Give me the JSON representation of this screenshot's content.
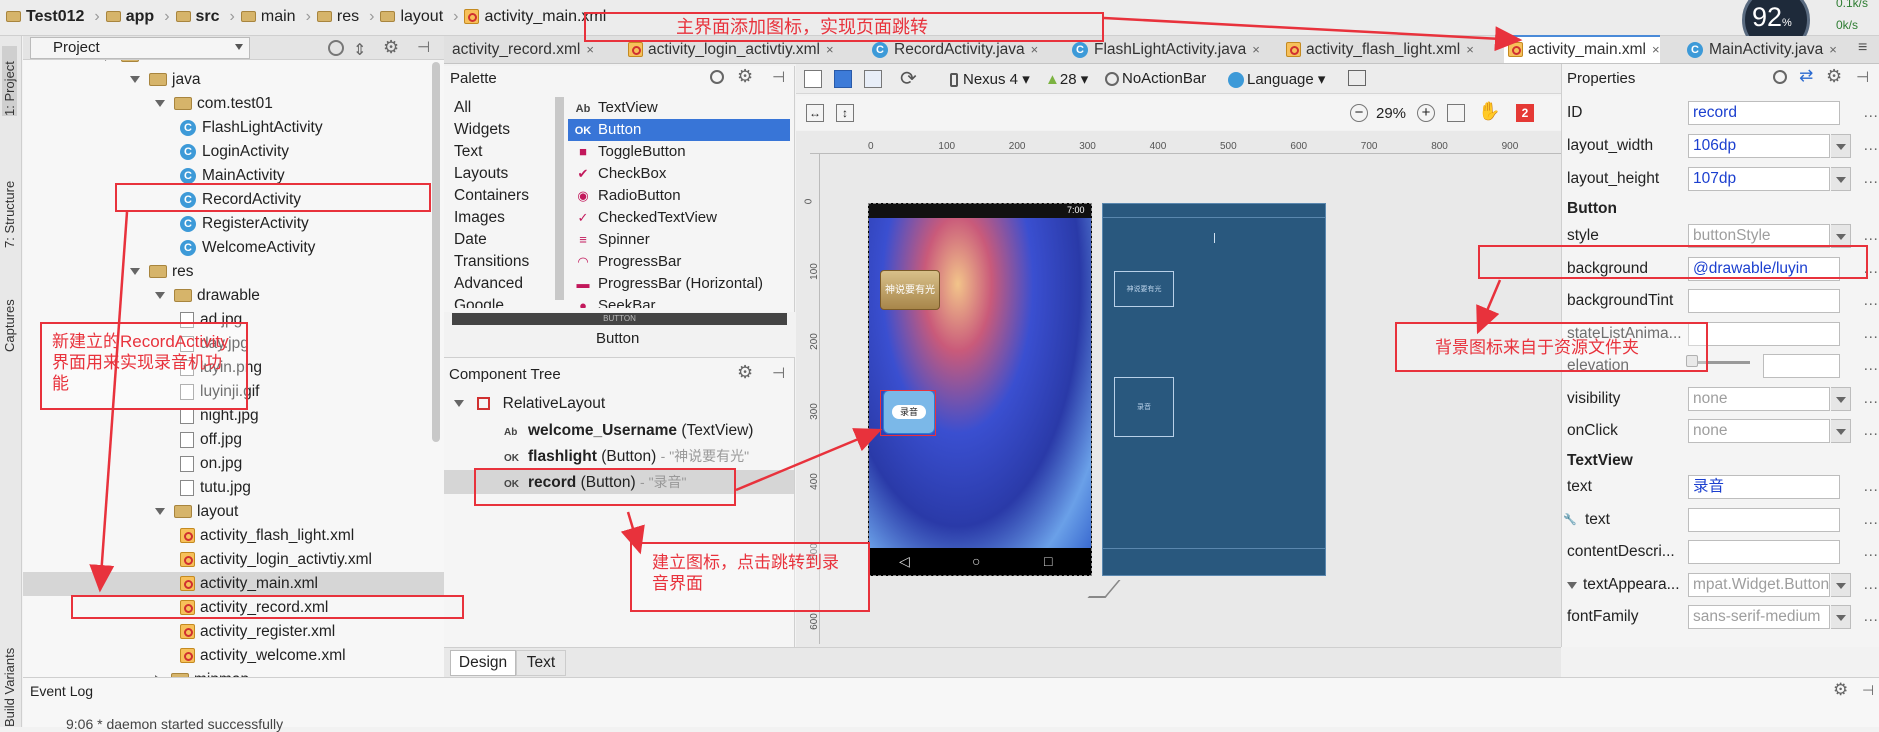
{
  "breadcrumb": [
    "Test012",
    "app",
    "src",
    "main",
    "res",
    "layout",
    "activity_main.xml"
  ],
  "cpu": {
    "value": "92",
    "unit": "%",
    "net_up": "0.1k/s",
    "net_down": "0k/s"
  },
  "left_tabs": [
    "1: Project",
    "7: Structure",
    "Captures",
    "Build Variants"
  ],
  "project": {
    "header": "Project",
    "rows": [
      {
        "label": "main",
        "kind": "folder",
        "indent": 0
      },
      {
        "label": "java",
        "kind": "folder",
        "indent": 1,
        "open": true
      },
      {
        "label": "com.test01",
        "kind": "folder",
        "indent": 2,
        "open": true
      },
      {
        "label": "FlashLightActivity",
        "kind": "class",
        "indent": 3
      },
      {
        "label": "LoginActivity",
        "kind": "class",
        "indent": 3
      },
      {
        "label": "MainActivity",
        "kind": "class",
        "indent": 3
      },
      {
        "label": "RecordActivity",
        "kind": "class",
        "indent": 3
      },
      {
        "label": "RegisterActivity",
        "kind": "class",
        "indent": 3
      },
      {
        "label": "WelcomeActivity",
        "kind": "class",
        "indent": 3
      },
      {
        "label": "res",
        "kind": "folder",
        "indent": 1,
        "open": true
      },
      {
        "label": "drawable",
        "kind": "folder",
        "indent": 2,
        "open": true
      },
      {
        "label": "ad.jpg",
        "kind": "img",
        "indent": 3
      },
      {
        "label": "day.jpg",
        "kind": "img",
        "indent": 3
      },
      {
        "label": "luyin.png",
        "kind": "img",
        "indent": 3
      },
      {
        "label": "luyinji.gif",
        "kind": "img",
        "indent": 3
      },
      {
        "label": "night.jpg",
        "kind": "img",
        "indent": 3
      },
      {
        "label": "off.jpg",
        "kind": "img",
        "indent": 3
      },
      {
        "label": "on.jpg",
        "kind": "img",
        "indent": 3
      },
      {
        "label": "tutu.jpg",
        "kind": "img",
        "indent": 3
      },
      {
        "label": "layout",
        "kind": "folder",
        "indent": 2,
        "open": true
      },
      {
        "label": "activity_flash_light.xml",
        "kind": "xml",
        "indent": 3
      },
      {
        "label": "activity_login_activtiy.xml",
        "kind": "xml",
        "indent": 3
      },
      {
        "label": "activity_main.xml",
        "kind": "xml",
        "indent": 3,
        "selected": true
      },
      {
        "label": "activity_record.xml",
        "kind": "xml",
        "indent": 3
      },
      {
        "label": "activity_register.xml",
        "kind": "xml",
        "indent": 3
      },
      {
        "label": "activity_welcome.xml",
        "kind": "xml",
        "indent": 3
      },
      {
        "label": "mipmap",
        "kind": "folder",
        "indent": 2
      }
    ]
  },
  "tabs": [
    {
      "label": "activity_record.xml"
    },
    {
      "label": "activity_login_activtiy.xml"
    },
    {
      "label": "RecordActivity.java"
    },
    {
      "label": "FlashLightActivity.java"
    },
    {
      "label": "activity_flash_light.xml"
    },
    {
      "label": "activity_main.xml",
      "active": true
    },
    {
      "label": "MainActivity.java"
    }
  ],
  "palette": {
    "title": "Palette",
    "categories": [
      "All",
      "Widgets",
      "Text",
      "Layouts",
      "Containers",
      "Images",
      "Date",
      "Transitions",
      "Advanced",
      "Google"
    ],
    "items": [
      {
        "icon": "Ab",
        "label": "TextView"
      },
      {
        "icon": "OK",
        "label": "Button",
        "selected": true
      },
      {
        "icon": "■",
        "label": "ToggleButton"
      },
      {
        "icon": "✔",
        "label": "CheckBox"
      },
      {
        "icon": "◉",
        "label": "RadioButton"
      },
      {
        "icon": "✓",
        "label": "CheckedTextView"
      },
      {
        "icon": "≡",
        "label": "Spinner"
      },
      {
        "icon": "◠",
        "label": "ProgressBar"
      },
      {
        "icon": "▬",
        "label": "ProgressBar (Horizontal)"
      },
      {
        "icon": "●",
        "label": "SeekBar"
      }
    ],
    "preview_button": "Button",
    "preview_small": "BUTTON"
  },
  "component_tree": {
    "title": "Component Tree",
    "root": "RelativeLayout",
    "children": [
      {
        "icon": "Ab",
        "id": "welcome_Username",
        "type": "(TextView)",
        "text": ""
      },
      {
        "icon": "OK",
        "id": "flashlight",
        "type": "(Button)",
        "text": "- \"神说要有光\""
      },
      {
        "icon": "OK",
        "id": "record",
        "type": "(Button)",
        "text": "- \"录音\"",
        "selected": true
      }
    ]
  },
  "toolbar": {
    "device": "Nexus 4",
    "api": "28",
    "theme": "NoActionBar",
    "language": "Language",
    "zoom": "29%",
    "warnings": "2"
  },
  "ruler": {
    "h": [
      "0",
      "100",
      "200",
      "300",
      "400",
      "500",
      "600",
      "700",
      "800",
      "900"
    ],
    "v": [
      "0",
      "100",
      "200",
      "300",
      "400",
      "500",
      "600"
    ]
  },
  "phone": {
    "time": "7:00",
    "flash_label": "神说要有光",
    "record_label": "录音",
    "blueprint_label1": "神说要有光",
    "blueprint_label2": "录音"
  },
  "properties": {
    "title": "Properties",
    "rows": [
      {
        "label": "ID",
        "value": "record"
      },
      {
        "label": "layout_width",
        "value": "106dp",
        "dropdown": true
      },
      {
        "label": "layout_height",
        "value": "107dp",
        "dropdown": true
      }
    ],
    "button_section": "Button",
    "button_rows": [
      {
        "label": "style",
        "value": "buttonStyle",
        "dropdown": true,
        "gray": true
      },
      {
        "label": "background",
        "value": "@drawable/luyin"
      },
      {
        "label": "backgroundTint",
        "value": ""
      },
      {
        "label": "stateListAnima...",
        "value": ""
      },
      {
        "label": "elevation",
        "value": ""
      },
      {
        "label": "visibility",
        "value": "none",
        "dropdown": true,
        "gray": true
      },
      {
        "label": "onClick",
        "value": "none",
        "dropdown": true,
        "gray": true
      }
    ],
    "textview_section": "TextView",
    "textview_rows": [
      {
        "label": "text",
        "value": "录音"
      },
      {
        "label": "text",
        "value": "",
        "wrench": true
      },
      {
        "label": "contentDescri...",
        "value": ""
      },
      {
        "label": "textAppeara...",
        "value": "mpat.Widget.Button",
        "dropdown": true,
        "gray": true,
        "expand": true
      },
      {
        "label": "fontFamily",
        "value": "sans-serif-medium",
        "dropdown": true,
        "gray": true
      }
    ]
  },
  "bottom_tabs": [
    "Design",
    "Text"
  ],
  "event_log": {
    "title": "Event Log",
    "message": "9:06 * daemon started successfully"
  },
  "annotations": {
    "top": "主界面添加图标，实现页面跳转",
    "left": "新建立的RecordActivity界面用来实现录音机功能",
    "middle": "建立图标，点击跳转到录音界面",
    "right": "背景图标来自于资源文件夹"
  }
}
